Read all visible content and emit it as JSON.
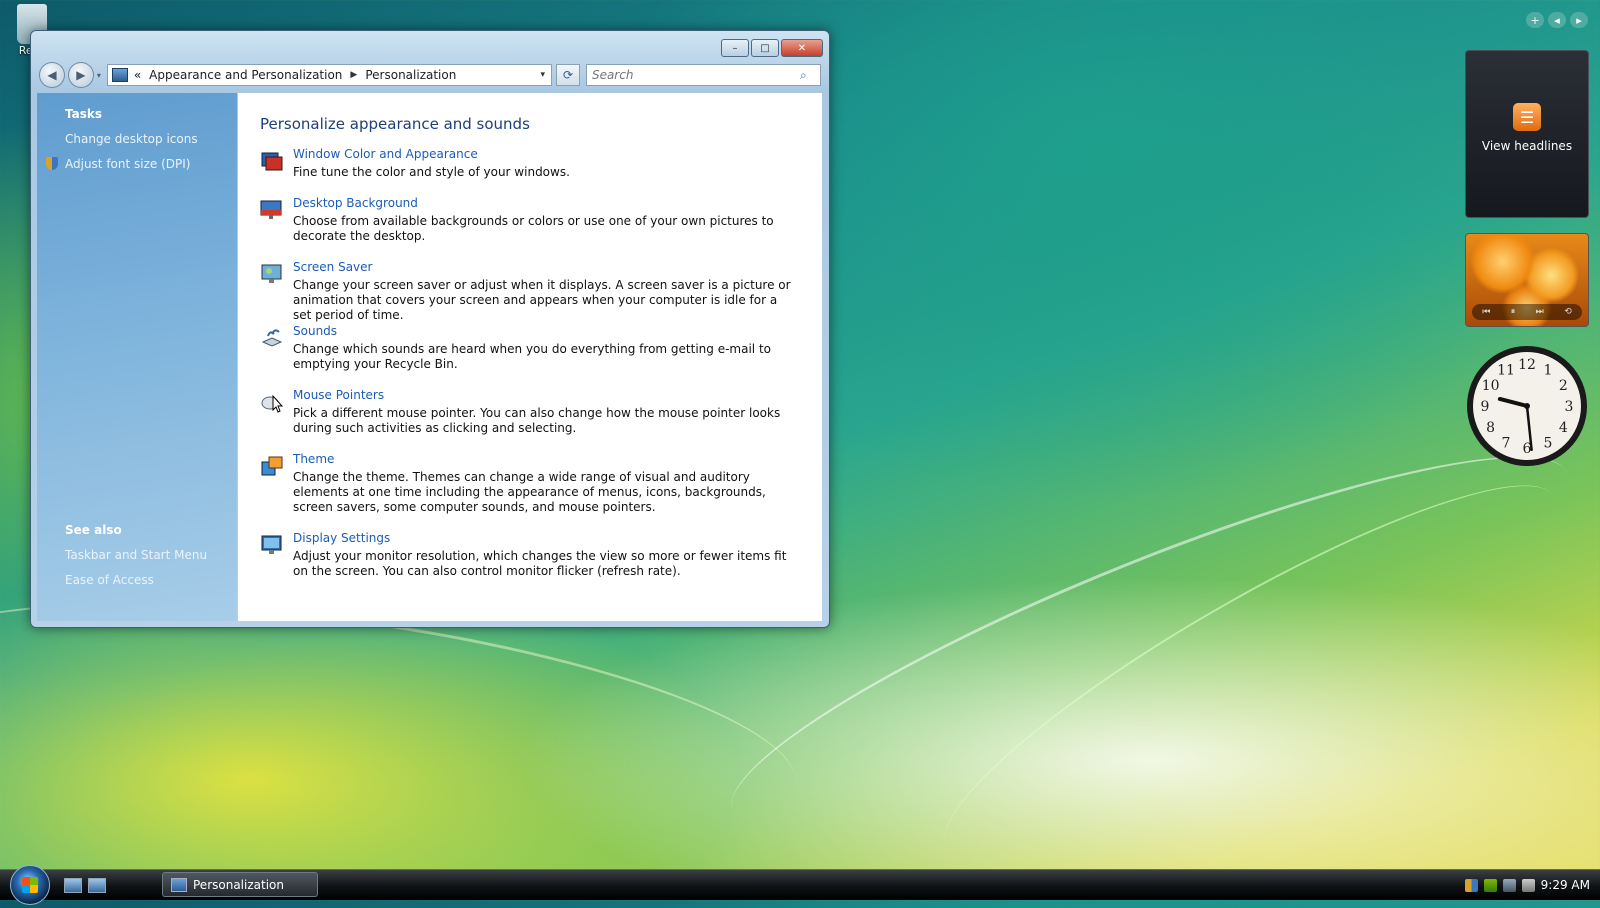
{
  "desktop": {
    "recycle_label": "Recy"
  },
  "window": {
    "caption_buttons": {
      "minimize": "–",
      "maximize": "□",
      "close": "✕"
    },
    "nav": {
      "back": "◀",
      "forward": "▶",
      "dropdown": "▾"
    },
    "breadcrumb": {
      "overflow": "«",
      "parent": "Appearance and Personalization",
      "separator": "▶",
      "current": "Personalization",
      "dropdown": "▾"
    },
    "refresh_glyph": "⟳",
    "search": {
      "placeholder": "Search",
      "icon_glyph": "⌕"
    },
    "sidebar": {
      "tasks_heading": "Tasks",
      "tasks": [
        "Change desktop icons",
        "Adjust font size (DPI)"
      ],
      "see_also_heading": "See also",
      "see_also": [
        "Taskbar and Start Menu",
        "Ease of Access"
      ]
    },
    "content": {
      "title": "Personalize appearance and sounds",
      "items": [
        {
          "link": "Window Color and Appearance",
          "desc": "Fine tune the color and style of your windows.",
          "icon": "window-color-icon"
        },
        {
          "link": "Desktop Background",
          "desc": "Choose from available backgrounds or colors or use one of your own pictures to decorate the desktop.",
          "icon": "desktop-background-icon"
        },
        {
          "link": "Screen Saver",
          "desc": "Change your screen saver or adjust when it displays. A screen saver is a picture or animation that covers your screen and appears when your computer is idle for a set period of time.",
          "icon": "screen-saver-icon"
        },
        {
          "link": "Sounds",
          "desc": "Change which sounds are heard when you do everything from getting e-mail to emptying your Recycle Bin.",
          "icon": "sounds-icon"
        },
        {
          "link": "Mouse Pointers",
          "desc": "Pick a different mouse pointer. You can also change how the mouse pointer looks during such activities as clicking and selecting.",
          "icon": "mouse-pointer-icon"
        },
        {
          "link": "Theme",
          "desc": "Change the theme. Themes can change a wide range of visual and auditory elements at one time including the appearance of menus, icons, backgrounds, screen savers, some computer sounds, and mouse pointers.",
          "icon": "theme-icon"
        },
        {
          "link": "Display Settings",
          "desc": "Adjust your monitor resolution, which changes the view so more or fewer items fit on the screen. You can also control monitor flicker (refresh rate).",
          "icon": "display-settings-icon"
        }
      ]
    }
  },
  "gadgets": {
    "toolbar": {
      "add": "+",
      "prev": "◂",
      "next": "▸"
    },
    "feed": {
      "label": "View headlines",
      "icon_glyph": "☰"
    },
    "slideshow": {
      "controls": [
        "⏮",
        "⏸",
        "⏭",
        "⟲"
      ]
    },
    "clock": {
      "numbers": [
        "12",
        "1",
        "2",
        "3",
        "4",
        "5",
        "6",
        "7",
        "8",
        "9",
        "10",
        "11"
      ],
      "hour": 9,
      "minute": 29
    }
  },
  "taskbar": {
    "task_label": "Personalization",
    "time": "9:29 AM"
  },
  "colors": {
    "link": "#1b5cb8",
    "heading": "#1e3f7a",
    "sidebar_top": "#5f9ccf",
    "sidebar_bottom": "#a7cde8"
  }
}
